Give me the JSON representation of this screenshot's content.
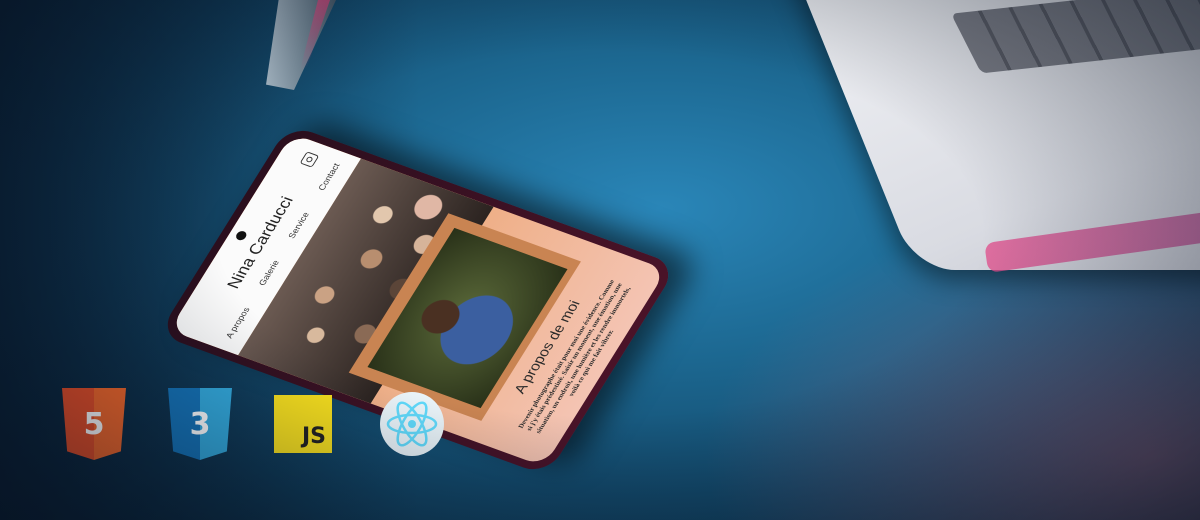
{
  "phone_site": {
    "brand": "Nina Carducci",
    "nav": [
      "A propos",
      "Galerie",
      "Service",
      "Contact"
    ],
    "about_title": "A propos de moi",
    "about_text": "Devenir photographe était pour moi une évidence. Comme si j'y étais prédestiné. Saisir un moment, une émotion, une situation, un endroit, une lumière et les rendre immortels, voilà ce qui me fait vibrer."
  },
  "tech_logos": [
    {
      "name": "html5-logo",
      "label": "5"
    },
    {
      "name": "css3-logo",
      "label": "3"
    },
    {
      "name": "javascript-logo",
      "label": "JS"
    },
    {
      "name": "react-logo",
      "label": ""
    }
  ],
  "colors": {
    "background": "#1c6790",
    "accent_orange": "#e59763",
    "html5": "#e34c26",
    "css3": "#1572b6",
    "js": "#f7df1e",
    "react": "#61dafb"
  }
}
